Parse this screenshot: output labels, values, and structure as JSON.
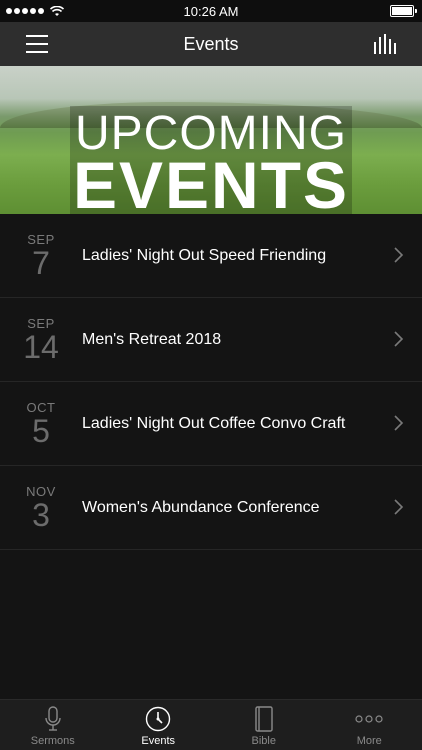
{
  "status_bar": {
    "time": "10:26 AM"
  },
  "nav": {
    "title": "Events"
  },
  "hero": {
    "line1": "UPCOMING",
    "line2": "EVENTS"
  },
  "events": [
    {
      "month": "SEP",
      "day": "7",
      "title": "Ladies' Night Out Speed Friending"
    },
    {
      "month": "SEP",
      "day": "14",
      "title": "Men's Retreat 2018"
    },
    {
      "month": "OCT",
      "day": "5",
      "title": "Ladies' Night Out Coffee Convo Craft"
    },
    {
      "month": "NOV",
      "day": "3",
      "title": "Women's Abundance Conference"
    }
  ],
  "tabs": [
    {
      "label": "Sermons",
      "icon": "microphone-icon"
    },
    {
      "label": "Events",
      "icon": "clock-icon"
    },
    {
      "label": "Bible",
      "icon": "book-icon"
    },
    {
      "label": "More",
      "icon": "more-dots-icon"
    }
  ]
}
